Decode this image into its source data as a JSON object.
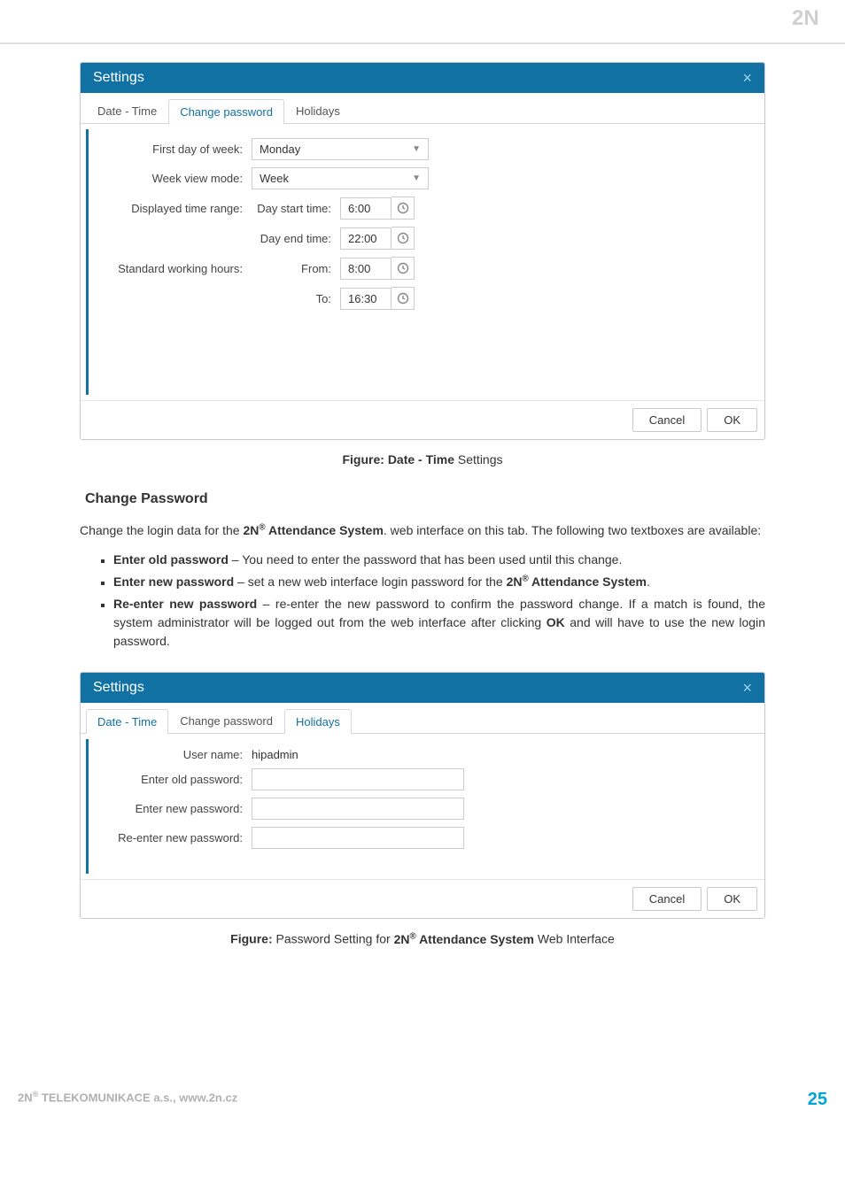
{
  "header": {
    "brand": "2N"
  },
  "modal1": {
    "title": "Settings",
    "tabs": {
      "datetime": "Date - Time",
      "changepw": "Change password",
      "holidays": "Holidays"
    },
    "rows": {
      "first_day_label": "First day of week:",
      "first_day_value": "Monday",
      "week_view_label": "Week view mode:",
      "week_view_value": "Week",
      "displayed_range_label": "Displayed time range:",
      "day_start_label": "Day start time:",
      "day_start_value": "6:00",
      "day_end_label": "Day end time:",
      "day_end_value": "22:00",
      "std_hours_label": "Standard working hours:",
      "from_label": "From:",
      "from_value": "8:00",
      "to_label": "To:",
      "to_value": "16:30"
    },
    "buttons": {
      "cancel": "Cancel",
      "ok": "OK"
    }
  },
  "caption1": {
    "prefix": "Figure: Date - Time",
    "suffix": " Settings"
  },
  "section_heading": "Change Password",
  "paragraph": {
    "part1": "Change the login data for the ",
    "brand": "2N",
    "reg": "®",
    "product": " Attendance System",
    "part2": ". web interface on this tab. The following two textboxes are available:"
  },
  "bullets": {
    "b1_bold": "Enter old password",
    "b1_rest": " – You need to enter the password that has been used until this change.",
    "b2_bold": "Enter new password",
    "b2_mid": " – set a new web interface login password for the ",
    "b2_brand": "2N",
    "b2_reg": "®",
    "b2_prod": " Attendance System",
    "b2_end": ".",
    "b3_bold": "Re-enter new password",
    "b3_mid": " – re-enter the new password to confirm the password change. If a match is found, the system administrator will be logged out from the web interface after clicking ",
    "b3_ok": "OK",
    "b3_end": " and will have to use the new login password."
  },
  "modal2": {
    "title": "Settings",
    "tabs": {
      "datetime": "Date - Time",
      "changepw": "Change password",
      "holidays": "Holidays"
    },
    "rows": {
      "username_label": "User name:",
      "username_value": "hipadmin",
      "oldpw_label": "Enter old password:",
      "newpw_label": "Enter new password:",
      "renewpw_label": "Re-enter new password:"
    },
    "buttons": {
      "cancel": "Cancel",
      "ok": "OK"
    }
  },
  "caption2": {
    "prefix": "Figure:",
    "mid1": " Password Setting for ",
    "brand": "2N",
    "reg": "®",
    "product": " Attendance System",
    "mid2": " Web Interface"
  },
  "footer": {
    "left1": "2N",
    "left_reg": "®",
    "left2": " TELEKOMUNIKACE a.s., www.2n.cz",
    "page": "25"
  }
}
